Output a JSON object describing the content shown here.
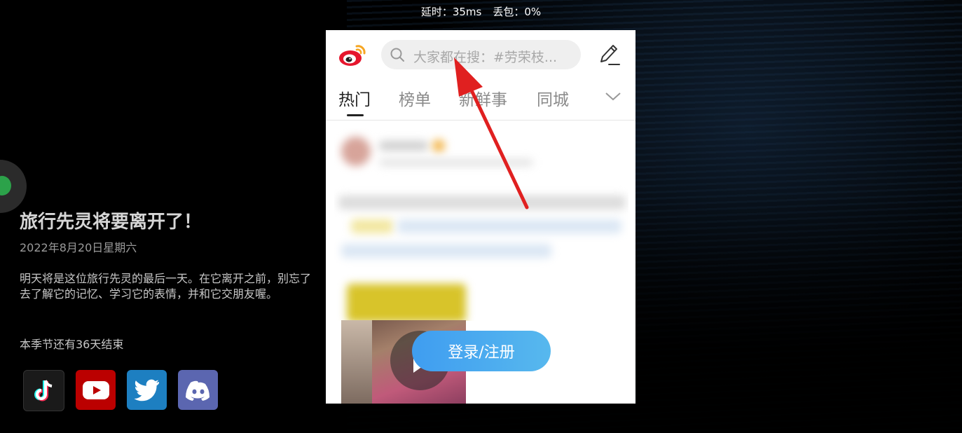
{
  "stats": {
    "latency": "延时：35ms",
    "packet_loss": "丢包：0%"
  },
  "info": {
    "title": "旅行先灵将要离开了！",
    "date": "2022年8月20日星期六",
    "description": "明天将是这位旅行先灵的最后一天。在它离开之前，别忘了去了解它的记忆、学习它的表情，并和它交朋友喔。",
    "season": "本季节还有36天结束"
  },
  "social_icons": [
    "tiktok-icon",
    "youtube-icon",
    "twitter-icon",
    "discord-icon"
  ],
  "weibo": {
    "search_placeholder": "大家都在搜：#劳荣枝...",
    "tabs": [
      {
        "label": "热门",
        "active": true
      },
      {
        "label": "榜单",
        "active": false
      },
      {
        "label": "新鲜事",
        "active": false
      },
      {
        "label": "同城",
        "active": false
      }
    ],
    "login_label": "登录/注册"
  },
  "colors": {
    "accent_blue": "#4aa8ef",
    "weibo_red": "#e6162d",
    "annotation_arrow": "#e02020"
  }
}
